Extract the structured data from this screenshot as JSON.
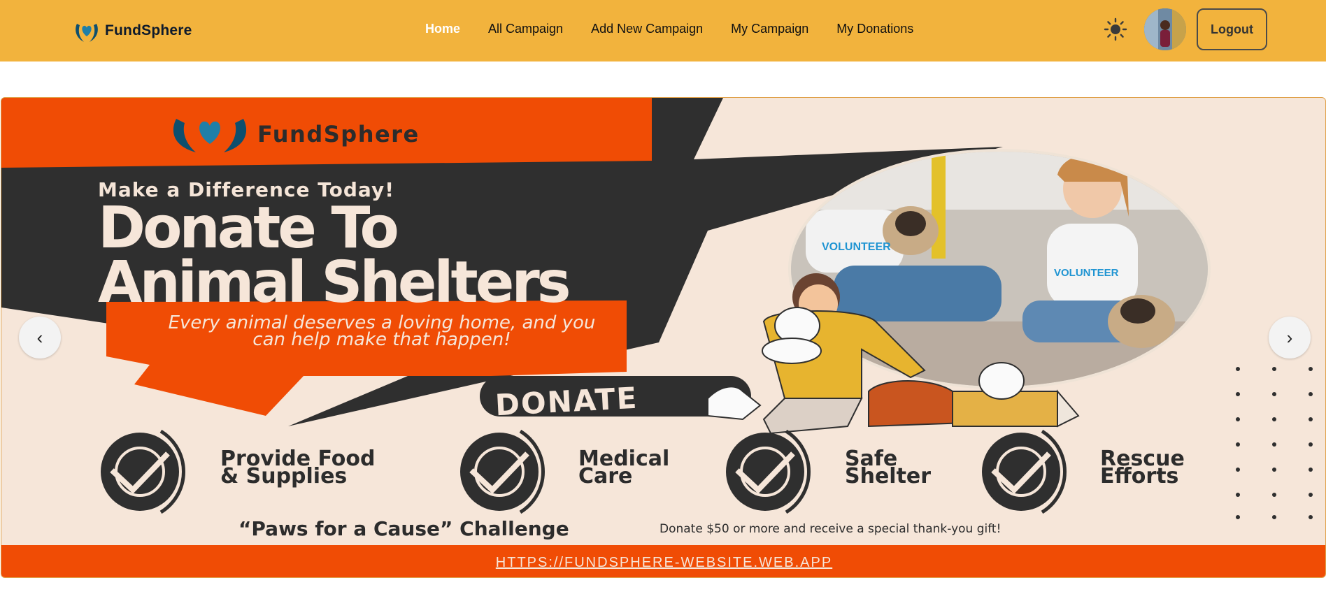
{
  "brand": {
    "name": "FundSphere",
    "logo_icon": "heart-hands-icon"
  },
  "nav": {
    "items": [
      {
        "label": "Home",
        "active": true
      },
      {
        "label": "All Campaign",
        "active": false
      },
      {
        "label": "Add New Campaign",
        "active": false
      },
      {
        "label": "My Campaign",
        "active": false
      },
      {
        "label": "My Donations",
        "active": false
      }
    ],
    "theme_icon": "sun-icon",
    "logout_label": "Logout"
  },
  "banner": {
    "brand": "FundSphere",
    "kicker": "Make a Difference Today!",
    "title_line1": "Donate To",
    "title_line2": "Animal Shelters",
    "subtitle": "Every animal deserves a loving home, and you can help make that happen!",
    "donate_label": "DONATE",
    "photo_labels": [
      "VOLUNTEER",
      "VOLUNTEER"
    ],
    "features": [
      {
        "label": "Provide Food\n& Supplies"
      },
      {
        "label": "Medical\nCare"
      },
      {
        "label": "Safe\nShelter"
      },
      {
        "label": "Rescue\nEfforts"
      }
    ],
    "challenge_title": "“Paws for a Cause” Challenge",
    "challenge_note": "Donate $50 or more and receive a special thank-you gift!",
    "url": "HTTPS://FUNDSPHERE-WEBSITE.WEB.APP",
    "prev_label": "‹",
    "next_label": "›"
  },
  "colors": {
    "nav_bg": "#f2b33d",
    "banner_orange": "#f04c05",
    "banner_dark": "#2f2f2f",
    "banner_cream": "#f6e6d9"
  }
}
